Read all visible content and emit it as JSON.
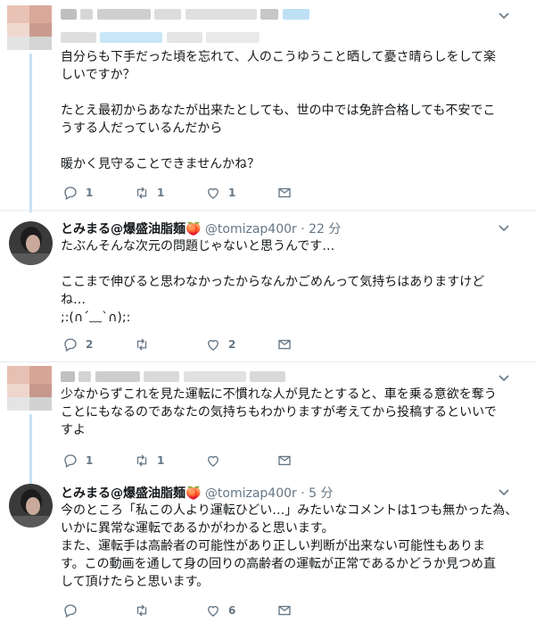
{
  "tweets": [
    {
      "name": "",
      "handle": "",
      "time": "",
      "text": "自分らも下手だった頃を忘れて、人のこうゆうこと晒して憂さ晴らしをして楽\nしいですか？\n\nたとえ最初からあなたが出来たとしても、世の中では免許合格しても不安でこ\nうする人だっているんだから\n\n暖かく見守ることできませんかね？",
      "reply_count": "1",
      "retweet_count": "1",
      "like_count": "1"
    },
    {
      "name": "とみまる@爆盛油脂麺🍑",
      "handle": "@tomizap400r",
      "time": "· 22 分",
      "text": "たぶんそんな次元の問題じゃないと思うんです…\n\nここまで伸びると思わなかったからなんかごめんって気持ちはありますけど\nね…\n;:(∩´﹏`∩);:",
      "reply_count": "2",
      "retweet_count": "",
      "like_count": "2"
    },
    {
      "name": "",
      "handle": "",
      "time": "",
      "text": "少なからずこれを見た運転に不慣れな人が見たとすると、車を乗る意欲を奪う\nことにもなるのであなたの気持ちもわかりますが考えてから投稿するといいで\nすよ",
      "reply_count": "1",
      "retweet_count": "1",
      "like_count": ""
    },
    {
      "name": "とみまる@爆盛油脂麺🍑",
      "handle": "@tomizap400r",
      "time": "· 5 分",
      "text": "今のところ「私この人より運転ひどい…」みたいなコメントは1つも無かった為、\nいかに異常な運転であるかがわかると思います。\nまた、運転手は高齢者の可能性があり正しい判断が出来ない可能性もありま\nす。この動画を通して身の回りの高齢者の運転が正常であるかどうか見つめ直\nして頂けたらと思います。",
      "reply_count": "",
      "retweet_count": "",
      "like_count": "6"
    }
  ],
  "colors": {
    "thread_line": "#c4e1f5",
    "secondary_text": "#657786",
    "divider": "#e6ecf0"
  },
  "icons": [
    "reply-icon",
    "retweet-icon",
    "like-icon",
    "message-icon",
    "chevron-down-icon"
  ]
}
